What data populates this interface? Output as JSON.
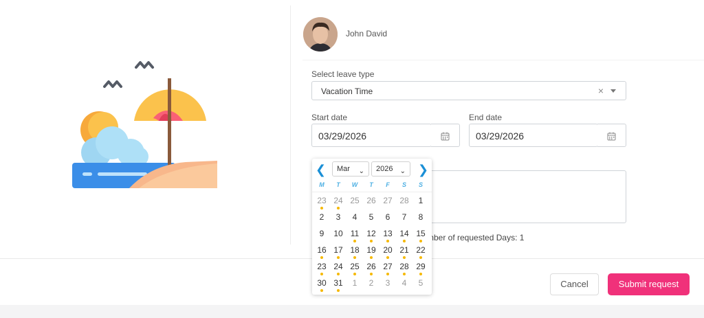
{
  "user": {
    "name": "John David"
  },
  "form": {
    "leave_type_label": "Select leave type",
    "leave_type_value": "Vacation Time",
    "clear_symbol": "×",
    "start_label": "Start date",
    "start_value": "03/29/2026",
    "end_label": "End date",
    "end_value": "03/29/2026",
    "days_note": "mber of requested Days: 1"
  },
  "buttons": {
    "cancel": "Cancel",
    "submit": "Submit request"
  },
  "calendar": {
    "month": "Mar",
    "year": "2026",
    "prev_symbol": "❮",
    "next_symbol": "❯",
    "weekdays": [
      "M",
      "T",
      "W",
      "T",
      "F",
      "S",
      "S"
    ],
    "weeks": [
      [
        {
          "d": "23",
          "out": true,
          "dot": true
        },
        {
          "d": "24",
          "out": true,
          "dot": true
        },
        {
          "d": "25",
          "out": true
        },
        {
          "d": "26",
          "out": true
        },
        {
          "d": "27",
          "out": true
        },
        {
          "d": "28",
          "out": true
        },
        {
          "d": "1"
        }
      ],
      [
        {
          "d": "2"
        },
        {
          "d": "3"
        },
        {
          "d": "4"
        },
        {
          "d": "5"
        },
        {
          "d": "6"
        },
        {
          "d": "7"
        },
        {
          "d": "8"
        }
      ],
      [
        {
          "d": "9"
        },
        {
          "d": "10"
        },
        {
          "d": "11",
          "dot": true
        },
        {
          "d": "12",
          "dot": true
        },
        {
          "d": "13",
          "dot": true
        },
        {
          "d": "14",
          "dot": true
        },
        {
          "d": "15",
          "dot": true
        }
      ],
      [
        {
          "d": "16",
          "dot": true
        },
        {
          "d": "17",
          "dot": true
        },
        {
          "d": "18",
          "dot": true
        },
        {
          "d": "19",
          "dot": true
        },
        {
          "d": "20",
          "dot": true
        },
        {
          "d": "21",
          "dot": true
        },
        {
          "d": "22",
          "dot": true
        }
      ],
      [
        {
          "d": "23",
          "dot": true
        },
        {
          "d": "24",
          "dot": true
        },
        {
          "d": "25",
          "dot": true
        },
        {
          "d": "26",
          "dot": true
        },
        {
          "d": "27",
          "dot": true
        },
        {
          "d": "28",
          "dot": true
        },
        {
          "d": "29",
          "dot": true
        }
      ],
      [
        {
          "d": "30",
          "dot": true
        },
        {
          "d": "31",
          "dot": true
        },
        {
          "d": "1",
          "out": true
        },
        {
          "d": "2",
          "out": true
        },
        {
          "d": "3",
          "out": true
        },
        {
          "d": "4",
          "out": true
        },
        {
          "d": "5",
          "out": true
        }
      ]
    ]
  },
  "colors": {
    "accent": "#f0317a",
    "calendar_nav": "#1a8fd6",
    "dot": "#f5b800"
  },
  "icons": {
    "illustration": "beach-umbrella-illustration",
    "calendar": "calendar-icon"
  }
}
